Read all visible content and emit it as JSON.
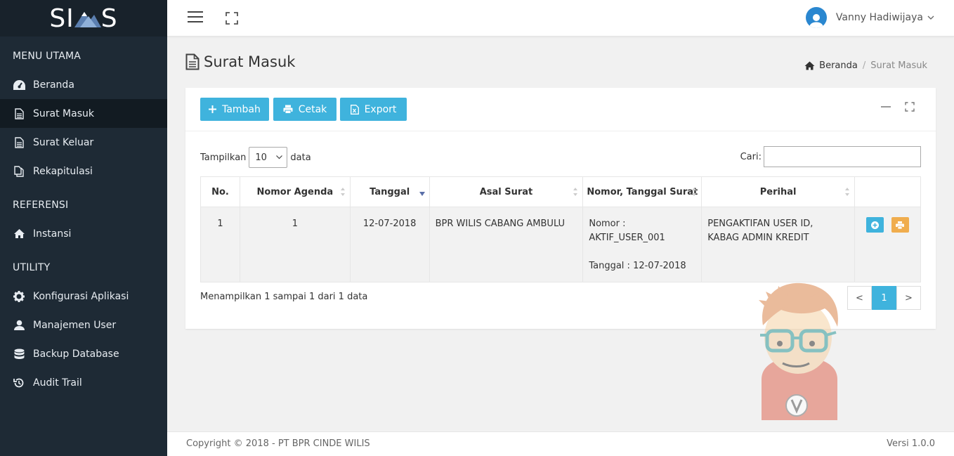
{
  "brand": {
    "logo_left": "SI",
    "logo_right": "S"
  },
  "sidebar": {
    "sections": [
      {
        "title": "MENU UTAMA"
      },
      {
        "title": "REFERENSI"
      },
      {
        "title": "UTILITY"
      }
    ],
    "items": [
      {
        "label": "Beranda",
        "icon": "dashboard-icon"
      },
      {
        "label": "Surat Masuk",
        "icon": "document-icon",
        "active": true
      },
      {
        "label": "Surat Keluar",
        "icon": "document-icon"
      },
      {
        "label": "Rekapitulasi",
        "icon": "copy-icon"
      },
      {
        "label": "Instansi",
        "icon": "home-icon"
      },
      {
        "label": "Konfigurasi Aplikasi",
        "icon": "gear-icon"
      },
      {
        "label": "Manajemen User",
        "icon": "user-icon"
      },
      {
        "label": "Backup Database",
        "icon": "database-icon"
      },
      {
        "label": "Audit Trail",
        "icon": "history-icon"
      }
    ]
  },
  "topbar": {
    "username": "Vanny Hadiwijaya"
  },
  "page": {
    "title": "Surat Masuk"
  },
  "breadcrumb": {
    "home": "Beranda",
    "separator": "/",
    "current": "Surat Masuk"
  },
  "toolbar": {
    "add_label": "Tambah",
    "print_label": "Cetak",
    "export_label": "Export"
  },
  "table_controls": {
    "show_prefix": "Tampilkan",
    "page_size": "10",
    "show_suffix": "data",
    "search_label": "Cari:",
    "search_value": ""
  },
  "table": {
    "headers": [
      "No.",
      "Nomor Agenda",
      "Tanggal",
      "Asal Surat",
      "Nomor, Tanggal Surat",
      "Perihal",
      ""
    ],
    "rows": [
      {
        "no": "1",
        "agenda": "1",
        "tanggal": "12-07-2018",
        "asal": "BPR WILIS CABANG AMBULU",
        "nomor_line1": "Nomor :",
        "nomor_line2": "AKTIF_USER_001",
        "tanggal_surat": "Tanggal : 12-07-2018",
        "perihal_line1": "PENGAKTIFAN USER ID,",
        "perihal_line2": "KABAG ADMIN KREDIT"
      }
    ]
  },
  "pagination": {
    "info": "Menampilkan 1 sampai 1 dari 1 data",
    "prev": "<",
    "page": "1",
    "next": ">"
  },
  "footer": {
    "copyright": "Copyright © 2018 - PT BPR CINDE WILIS",
    "version": "Versi 1.0.0"
  },
  "colors": {
    "sidebar_bg": "#1e2a35",
    "accent": "#3fb3dd",
    "warning": "#f0ad4e",
    "avatar": "#2a87d0"
  }
}
